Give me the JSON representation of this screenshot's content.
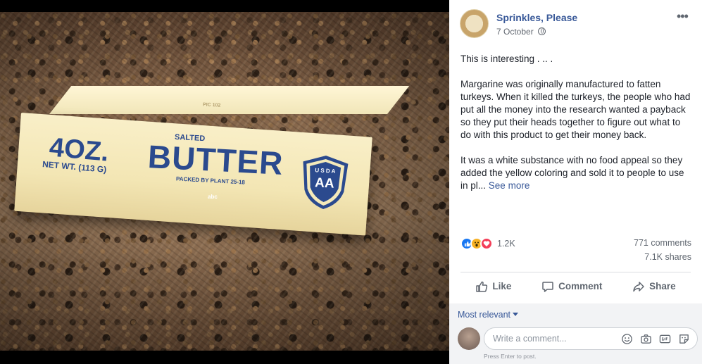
{
  "photo": {
    "package": {
      "weight": "4OZ.",
      "net_weight": "NET WT. (113 G)",
      "salted": "SALTED",
      "product": "BUTTER",
      "packed": "PACKED BY PLANT 25-18",
      "pic": "PIC 102",
      "shield_top": "U S D A",
      "shield_grade": "AA"
    },
    "watermark": "abc"
  },
  "post": {
    "page_name": "Sprinkles, Please",
    "date": "7 October",
    "more_label": "•••",
    "paragraphs": [
      "This is interesting . .. .",
      "Margarine was originally manufactured to fatten turkeys. When it killed the turkeys, the people who had put all the money into the research wanted a payback so they put their heads together to figure out what to do with this product to get their money back.",
      "It was a white substance with no food appeal so they added the yellow coloring and sold it to people to use in pl..."
    ],
    "see_more": "See more"
  },
  "stats": {
    "reaction_count": "1.2K",
    "comments": "771 comments",
    "shares": "7.1K shares"
  },
  "actions": {
    "like": "Like",
    "comment": "Comment",
    "share": "Share"
  },
  "comments": {
    "sort": "Most relevant",
    "placeholder": "Write a comment...",
    "hint": "Press Enter to post."
  },
  "colors": {
    "link": "#385898",
    "like": "#1877f2",
    "love": "#f33e58",
    "wow": "#f7b125"
  }
}
